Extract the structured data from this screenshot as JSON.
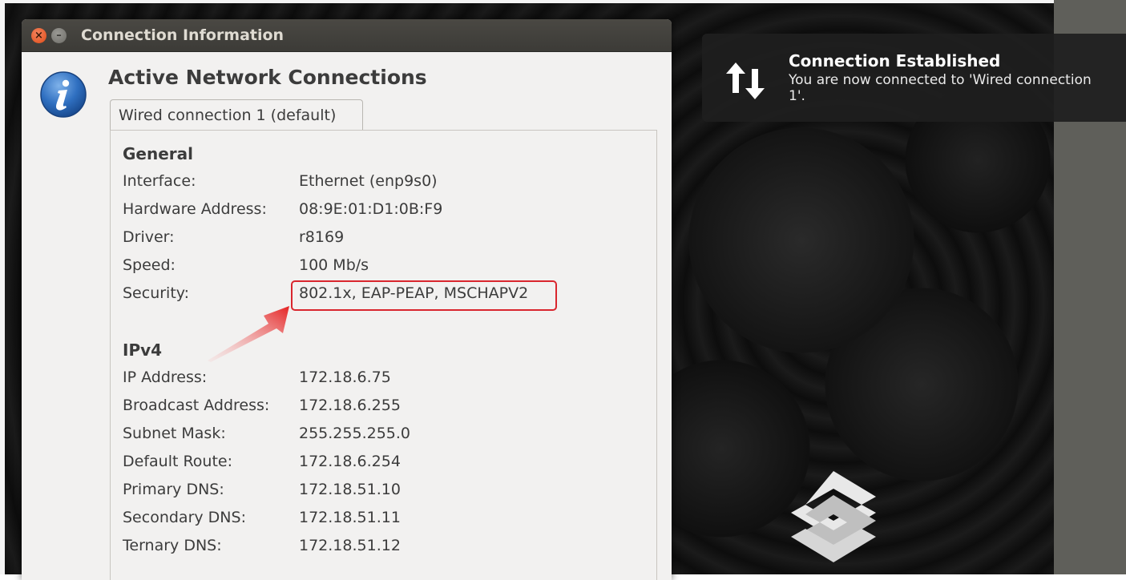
{
  "window": {
    "title": "Connection Information",
    "close_glyph": "×",
    "minimize_glyph": "–",
    "heading": "Active Network Connections",
    "tab_label": "Wired connection 1 (default)"
  },
  "general": {
    "section_title": "General",
    "rows": [
      {
        "label": "Interface:",
        "value": "Ethernet (enp9s0)"
      },
      {
        "label": "Hardware Address:",
        "value": "08:9E:01:D1:0B:F9"
      },
      {
        "label": "Driver:",
        "value": "r8169"
      },
      {
        "label": "Speed:",
        "value": "100 Mb/s"
      },
      {
        "label": "Security:",
        "value": "802.1x, EAP-PEAP, MSCHAPV2"
      }
    ]
  },
  "ipv4": {
    "section_title": "IPv4",
    "rows": [
      {
        "label": "IP Address:",
        "value": "172.18.6.75"
      },
      {
        "label": "Broadcast Address:",
        "value": "172.18.6.255"
      },
      {
        "label": "Subnet Mask:",
        "value": "255.255.255.0"
      },
      {
        "label": "Default Route:",
        "value": "172.18.6.254"
      },
      {
        "label": "Primary DNS:",
        "value": "172.18.51.10"
      },
      {
        "label": "Secondary DNS:",
        "value": "172.18.51.11"
      },
      {
        "label": "Ternary DNS:",
        "value": "172.18.51.12"
      }
    ]
  },
  "notification": {
    "title": "Connection Established",
    "body": "You are now connected to 'Wired connection 1'."
  },
  "icons": {
    "info": "info-icon",
    "network": "network-transfer-icon",
    "logo": "brand-logo"
  },
  "colors": {
    "highlight": "#d9262e",
    "close_button": "#df4b16",
    "titlebar": "#3c3b37"
  }
}
